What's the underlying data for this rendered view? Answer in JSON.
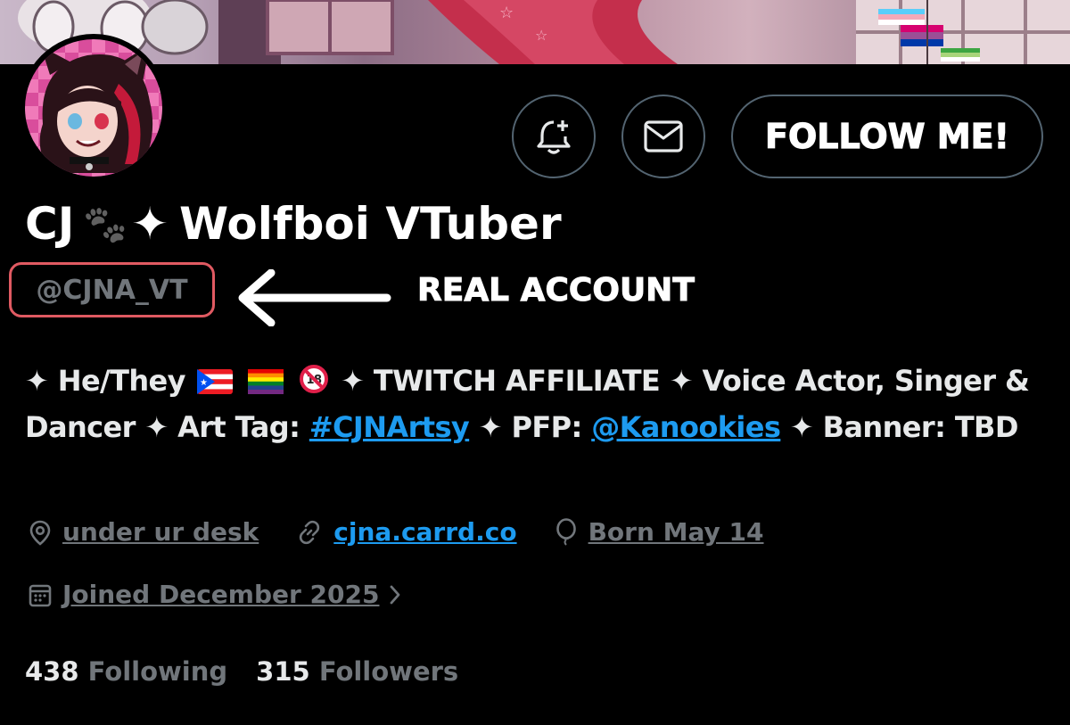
{
  "header": {
    "follow_button_label": "FOLLOW ME!",
    "notify_icon": "bell-plus-icon",
    "message_icon": "envelope-icon"
  },
  "profile": {
    "name_prefix": "CJ",
    "name_emoji": "🐾",
    "name_sparkle": "✦",
    "name_suffix": "Wolfboi VTuber",
    "handle": "@CJNA_VT",
    "annotation": "REAL ACCOUNT",
    "annotation_color": "#e05a62",
    "bio": {
      "sparkle": "✦",
      "pronouns": "He/They",
      "segment_twitch": "✦ TWITCH AFFILIATE ✦ Voice Actor, Singer & Dancer ✦ Art Tag:",
      "art_tag": "#CJNArtsy",
      "segment_pfp": "✦ PFP:",
      "pfp_handle": "@Kanookies",
      "segment_banner": "✦ Banner: TBD"
    },
    "location": "under ur desk",
    "website": "cjna.carrd.co",
    "birthday": "Born May 14",
    "joined": "Joined December 2025"
  },
  "stats": {
    "following_count": "438",
    "following_label": "Following",
    "followers_count": "315",
    "followers_label": "Followers"
  },
  "colors": {
    "background": "#000000",
    "link": "#1d9bf0",
    "muted": "#71767b",
    "text": "#e7e9ea",
    "button_border": "#536471"
  }
}
